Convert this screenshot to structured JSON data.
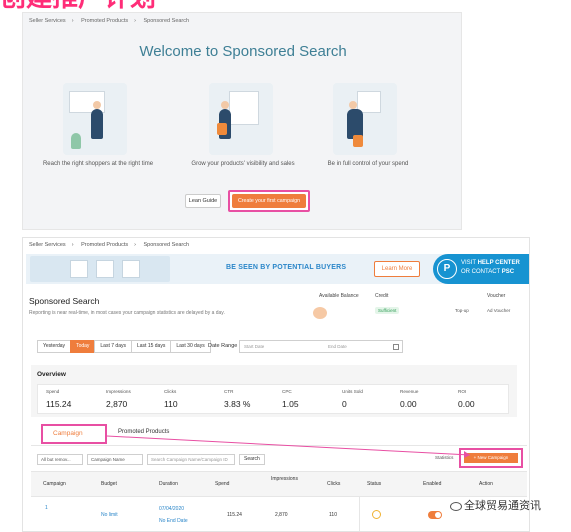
{
  "top_heading": "创建推广计划",
  "welcome_panel": {
    "breadcrumb": [
      "Seller Services",
      "Promoted Products",
      "Sponsored Search"
    ],
    "title": "Welcome to Sponsored Search",
    "captions": [
      "Reach the right shoppers at the right time",
      "Grow your products' visibility and sales",
      "Be in full control of your spend"
    ],
    "guide_label": "Lean Guide",
    "create_label": "Create your first campaign"
  },
  "dashboard": {
    "breadcrumb": [
      "Seller Services",
      "Promoted Products",
      "Sponsored Search"
    ],
    "banner": {
      "headline": "BE SEEN BY POTENTIAL BUYERS",
      "learn_more": "Learn More",
      "help_icon": "P",
      "help_line1_a": "VISIT ",
      "help_line1_b": "HELP CENTER",
      "help_line2_a": "OR CONTACT ",
      "help_line2_b": "PSC"
    },
    "title": "Sponsored Search",
    "subtitle": "Reporting is near real-time, in most cases your campaign statistics are delayed by a day.",
    "account": {
      "available_balance_label": "Available Balance",
      "credit_label": "Credit",
      "credit_status": "Sufficient",
      "topup_label": "Top-up",
      "voucher_label": "Voucher",
      "voucher_value": "Ad Voucher"
    },
    "date_buttons": [
      "Yesterday",
      "Today",
      "Last 7 days",
      "Last 15 days",
      "Last 30 days"
    ],
    "date_active_index": 1,
    "date_range_label": "Date Range",
    "start_date_placeholder": "Start Date",
    "end_date_placeholder": "End Date",
    "overview": {
      "title": "Overview",
      "metrics": [
        {
          "label": "Spend",
          "value": "115.24"
        },
        {
          "label": "Impressions",
          "value": "2,870"
        },
        {
          "label": "Clicks",
          "value": "110"
        },
        {
          "label": "CTR",
          "value": "3.83 %"
        },
        {
          "label": "CPC",
          "value": "1.05"
        },
        {
          "label": "Units Sold",
          "value": "0"
        },
        {
          "label": "Revenue",
          "value": "0.00"
        },
        {
          "label": "ROI",
          "value": "0.00"
        }
      ]
    },
    "tabs": {
      "campaign": "Campaign",
      "promoted": "Promoted Products"
    },
    "statistics_label": "Statistics",
    "new_campaign_label": "+ New Campaign",
    "filters": {
      "status": "All but remov...",
      "field": "Campaign Name",
      "search_placeholder": "Search Campaign Name/Campaign ID",
      "search_button": "Search"
    },
    "table": {
      "headers": [
        "Campaign",
        "Budget",
        "Duration",
        "Spend",
        "Impressions",
        "Clicks",
        "Status",
        "Enabled",
        "Action"
      ],
      "row": {
        "campaign": "1",
        "budget": "No limit",
        "duration_start": "07/04/2020",
        "duration_end": "No End Date",
        "spend": "115.24",
        "impressions": "2,870",
        "clicks": "110"
      }
    }
  },
  "watermark": "全球贸易通资讯"
}
